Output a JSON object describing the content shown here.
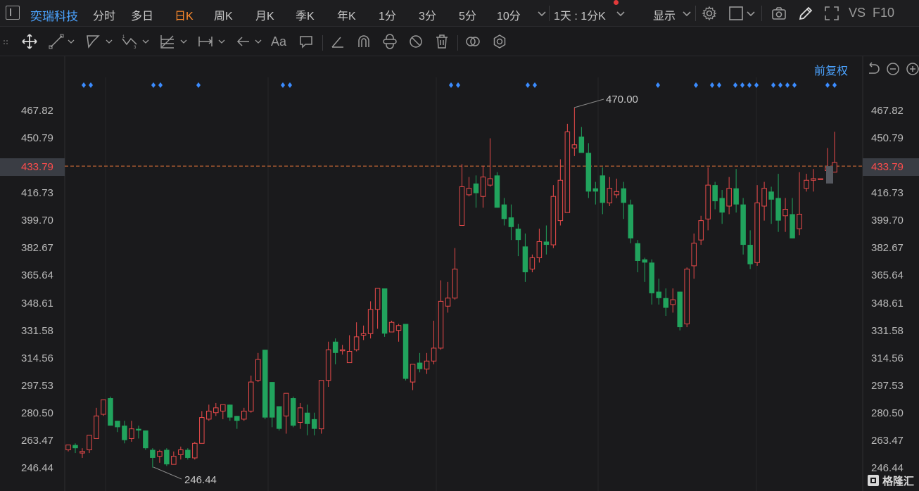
{
  "stock": {
    "name": "奕瑞科技"
  },
  "periods": [
    "分时",
    "多日",
    "日K",
    "周K",
    "月K",
    "季K",
    "年K",
    "1分",
    "3分",
    "5分",
    "10分"
  ],
  "active_period": "日K",
  "toolbar": {
    "minute_select": "1天 : 1分K",
    "display_label": "显示",
    "vs_label": "VS",
    "f10_label": "F10"
  },
  "drawing": {
    "text_tool": "Aa"
  },
  "chart": {
    "adjust_label": "前复权",
    "accent_up": "#e94a4a",
    "accent_down": "#21a35d",
    "current_price_color": "#ff4d4d",
    "current_price": "433.79"
  },
  "brand": {
    "name": "格隆汇"
  },
  "chart_data": {
    "type": "candlestick",
    "y_ticks": [
      "467.82",
      "450.79",
      "433.79",
      "416.73",
      "399.70",
      "382.67",
      "365.64",
      "348.61",
      "331.58",
      "314.56",
      "297.53",
      "280.50",
      "263.47",
      "246.44"
    ],
    "ylim": [
      246.44,
      467.82
    ],
    "max_annotation": "470.00",
    "min_annotation": "246.44",
    "reference_line": 433.79,
    "event_marker_count": 25,
    "candles": [
      [
        258,
        261,
        257,
        260
      ],
      [
        261,
        259,
        256,
        262
      ],
      [
        256,
        257,
        253,
        259
      ],
      [
        258,
        267,
        256,
        267
      ],
      [
        265,
        279,
        265,
        284
      ],
      [
        280,
        289,
        279,
        289
      ],
      [
        290,
        273,
        273,
        291
      ],
      [
        276,
        272,
        269,
        276
      ],
      [
        273,
        264,
        262,
        276
      ],
      [
        265,
        271,
        263,
        276
      ],
      [
        271,
        270,
        265,
        273
      ],
      [
        270,
        259,
        258,
        270
      ],
      [
        258,
        253,
        247,
        259
      ],
      [
        254,
        257,
        250,
        258
      ],
      [
        258,
        249,
        248,
        259
      ],
      [
        249,
        254,
        249,
        257
      ],
      [
        255,
        258,
        252,
        260
      ],
      [
        258,
        253,
        252,
        259
      ],
      [
        253,
        262,
        252,
        263
      ],
      [
        262,
        278,
        262,
        282
      ],
      [
        277,
        282,
        276,
        286
      ],
      [
        281,
        284,
        279,
        287
      ],
      [
        282,
        286,
        277,
        286
      ],
      [
        286,
        278,
        276,
        286
      ],
      [
        279,
        276,
        271,
        279
      ],
      [
        277,
        282,
        276,
        284
      ],
      [
        282,
        300,
        281,
        304
      ],
      [
        301,
        314,
        300,
        318
      ],
      [
        320,
        278,
        277,
        320
      ],
      [
        300,
        278,
        272,
        300
      ],
      [
        285,
        271,
        270,
        285
      ],
      [
        279,
        293,
        268,
        293
      ],
      [
        290,
        273,
        272,
        291
      ],
      [
        275,
        284,
        271,
        287
      ],
      [
        281,
        274,
        267,
        286
      ],
      [
        277,
        271,
        267,
        281
      ],
      [
        271,
        301,
        268,
        301
      ],
      [
        301,
        320,
        297,
        325
      ],
      [
        325,
        318,
        311,
        327
      ],
      [
        320,
        320,
        317,
        323
      ],
      [
        312,
        319,
        312,
        329
      ],
      [
        320,
        328,
        319,
        337
      ],
      [
        329,
        330,
        326,
        335
      ],
      [
        330,
        345,
        327,
        350
      ],
      [
        345,
        358,
        333,
        358
      ],
      [
        358,
        330,
        328,
        358
      ],
      [
        331,
        337,
        331,
        338
      ],
      [
        332,
        335,
        325,
        336
      ],
      [
        336,
        302,
        301,
        336
      ],
      [
        300,
        311,
        295,
        311
      ],
      [
        312,
        308,
        306,
        318
      ],
      [
        308,
        313,
        305,
        318
      ],
      [
        313,
        321,
        311,
        338
      ],
      [
        321,
        350,
        320,
        363
      ],
      [
        347,
        352,
        343,
        362
      ],
      [
        352,
        370,
        351,
        383
      ],
      [
        397,
        421,
        397,
        435
      ],
      [
        416,
        420,
        415,
        427
      ],
      [
        423,
        417,
        408,
        428
      ],
      [
        415,
        427,
        408,
        434
      ],
      [
        422,
        426,
        421,
        451
      ],
      [
        428,
        408,
        408,
        430
      ],
      [
        410,
        401,
        397,
        414
      ],
      [
        402,
        396,
        388,
        410
      ],
      [
        395,
        388,
        378,
        398
      ],
      [
        384,
        368,
        362,
        392
      ],
      [
        370,
        377,
        368,
        379
      ],
      [
        377,
        387,
        374,
        395
      ],
      [
        387,
        385,
        379,
        397
      ],
      [
        385,
        415,
        383,
        422
      ],
      [
        400,
        425,
        397,
        438
      ],
      [
        405,
        455,
        405,
        460
      ],
      [
        445,
        447,
        440,
        470
      ],
      [
        452,
        442,
        444,
        458
      ],
      [
        442,
        418,
        414,
        448
      ],
      [
        420,
        418,
        410,
        424
      ],
      [
        428,
        411,
        404,
        433
      ],
      [
        411,
        420,
        409,
        427
      ],
      [
        416,
        418,
        414,
        426
      ],
      [
        420,
        411,
        401,
        424
      ],
      [
        410,
        389,
        386,
        413
      ],
      [
        386,
        375,
        368,
        388
      ],
      [
        376,
        374,
        362,
        377
      ],
      [
        374,
        355,
        348,
        376
      ],
      [
        356,
        352,
        348,
        364
      ],
      [
        352,
        346,
        341,
        358
      ],
      [
        348,
        351,
        343,
        358
      ],
      [
        356,
        334,
        332,
        356
      ],
      [
        336,
        370,
        334,
        371
      ],
      [
        372,
        386,
        364,
        392
      ],
      [
        388,
        400,
        385,
        403
      ],
      [
        401,
        422,
        394,
        433
      ],
      [
        422,
        412,
        407,
        424
      ],
      [
        414,
        405,
        398,
        419
      ],
      [
        409,
        420,
        404,
        427
      ],
      [
        420,
        410,
        405,
        432
      ],
      [
        410,
        385,
        379,
        414
      ],
      [
        385,
        373,
        370,
        394
      ],
      [
        374,
        411,
        372,
        422
      ],
      [
        409,
        420,
        400,
        424
      ],
      [
        418,
        413,
        398,
        421
      ],
      [
        414,
        400,
        393,
        429
      ],
      [
        403,
        407,
        393,
        414
      ],
      [
        404,
        389,
        389,
        414
      ],
      [
        395,
        404,
        391,
        430
      ],
      [
        420,
        425,
        418,
        429
      ],
      [
        425,
        426,
        418,
        432
      ],
      [
        426,
        426,
        426,
        426
      ],
      [
        431,
        433,
        431,
        445
      ],
      [
        430,
        436,
        430,
        455
      ]
    ]
  }
}
